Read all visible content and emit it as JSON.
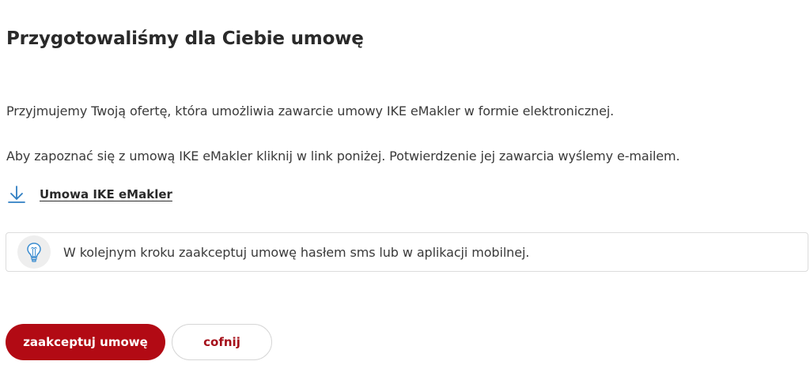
{
  "header": {
    "title": "Przygotowaliśmy dla Ciebie umowę"
  },
  "content": {
    "paragraph_1": "Przyjmujemy Twoją ofertę, która umożliwia zawarcie umowy IKE eMakler w formie elektronicznej.",
    "paragraph_2": "Aby zapoznać się z umową IKE eMakler kliknij w link poniżej. Potwierdzenie jej zawarcia wyślemy e-mailem."
  },
  "download": {
    "label": "Umowa IKE eMakler",
    "icon": "download-arrow-icon",
    "icon_color": "#2f7ec2"
  },
  "info": {
    "icon": "lightbulb-icon",
    "text": "W kolejnym kroku zaakceptuj umowę hasłem sms lub w aplikacji mobilnej."
  },
  "actions": {
    "accept_label": "zaakceptuj umowę",
    "back_label": "cofnij",
    "accent_color": "#b20a14"
  }
}
